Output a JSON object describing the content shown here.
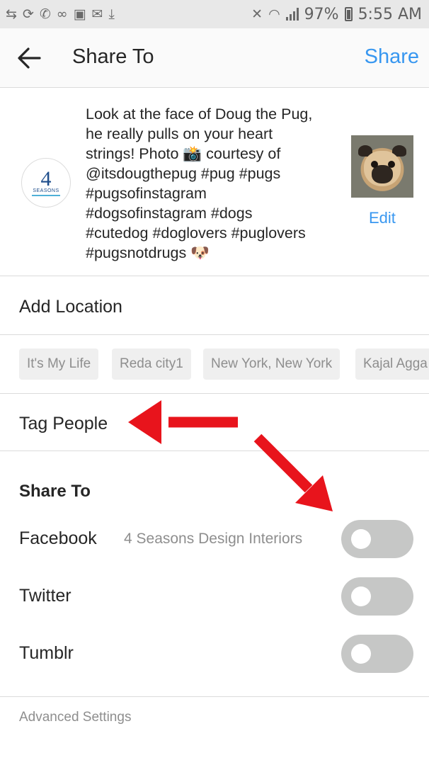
{
  "status_bar": {
    "left_icons": [
      "retweet-icon",
      "voicemail-sync-icon",
      "call-icon",
      "voicemail-icon",
      "image-icon",
      "mail-icon",
      "download-icon"
    ],
    "battery_percent": "97%",
    "time": "5:55 AM"
  },
  "header": {
    "title": "Share To",
    "share_label": "Share"
  },
  "post": {
    "caption": "Look at the face of Doug the Pug,\nhe really pulls on your heart\nstrings! Photo 📸 courtesy of\n@itsdougthepug #pug #pugs\n#pugsofinstagram\n#dogsofinstagram #dogs\n#cutedog #doglovers #puglovers\n#pugsnotdrugs 🐶",
    "avatar_logo_text": "4",
    "avatar_logo_word": "SEASONS",
    "edit_label": "Edit"
  },
  "location": {
    "add_label": "Add Location",
    "suggestions": [
      "It's My Life",
      "Reda city1",
      "New York, New York",
      "Kajal Agga"
    ]
  },
  "tag_people": {
    "label": "Tag People"
  },
  "share_to": {
    "title": "Share To",
    "networks": [
      {
        "name": "Facebook",
        "account": "4 Seasons Design Interiors",
        "enabled": false
      },
      {
        "name": "Twitter",
        "account": "",
        "enabled": false
      },
      {
        "name": "Tumblr",
        "account": "",
        "enabled": false
      }
    ]
  },
  "advanced_settings_label": "Advanced Settings",
  "colors": {
    "link": "#3897f0",
    "annotation_arrow": "#e8141c",
    "toggle_off": "#c6c7c6"
  }
}
